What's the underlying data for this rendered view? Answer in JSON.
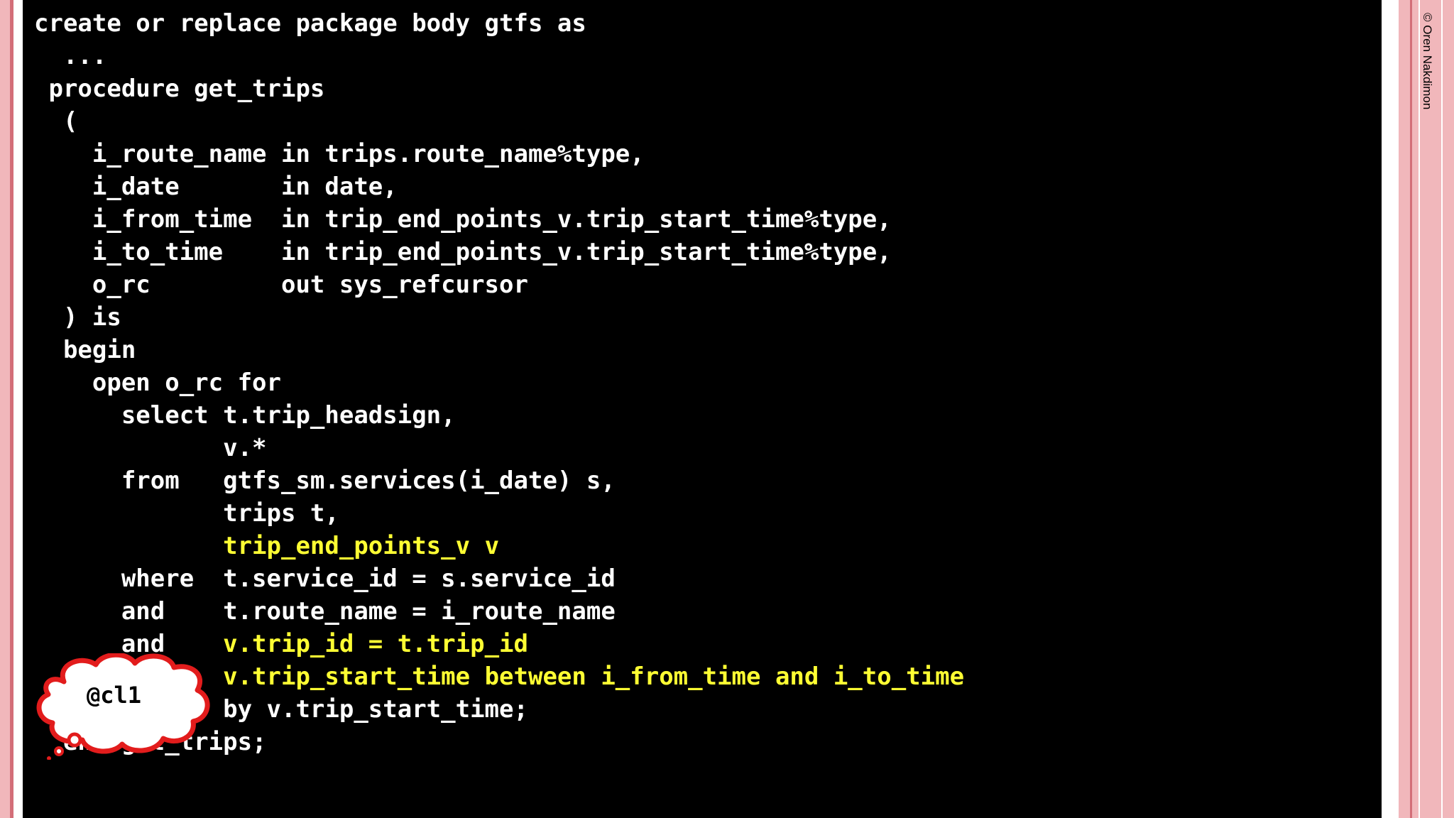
{
  "slide": {
    "copyright": "© Oren Nakdimon",
    "annotation": "@cl1"
  },
  "code": {
    "lines": [
      {
        "segments": [
          {
            "text": "create or replace package body gtfs as",
            "hl": false
          }
        ]
      },
      {
        "segments": [
          {
            "text": "  ...",
            "hl": false
          }
        ]
      },
      {
        "segments": [
          {
            "text": " procedure get_trips",
            "hl": false
          }
        ]
      },
      {
        "segments": [
          {
            "text": "  (",
            "hl": false
          }
        ]
      },
      {
        "segments": [
          {
            "text": "    i_route_name in trips.route_name%type,",
            "hl": false
          }
        ]
      },
      {
        "segments": [
          {
            "text": "    i_date       in date,",
            "hl": false
          }
        ]
      },
      {
        "segments": [
          {
            "text": "    i_from_time  in trip_end_points_v.trip_start_time%type,",
            "hl": false
          }
        ]
      },
      {
        "segments": [
          {
            "text": "    i_to_time    in trip_end_points_v.trip_start_time%type,",
            "hl": false
          }
        ]
      },
      {
        "segments": [
          {
            "text": "    o_rc         out sys_refcursor",
            "hl": false
          }
        ]
      },
      {
        "segments": [
          {
            "text": "  ) is",
            "hl": false
          }
        ]
      },
      {
        "segments": [
          {
            "text": "  begin",
            "hl": false
          }
        ]
      },
      {
        "segments": [
          {
            "text": "    open o_rc for",
            "hl": false
          }
        ]
      },
      {
        "segments": [
          {
            "text": "      select t.trip_headsign,",
            "hl": false
          }
        ]
      },
      {
        "segments": [
          {
            "text": "             v.*",
            "hl": false
          }
        ]
      },
      {
        "segments": [
          {
            "text": "      from   gtfs_sm.services(i_date) s,",
            "hl": false
          }
        ]
      },
      {
        "segments": [
          {
            "text": "             trips t,",
            "hl": false
          }
        ]
      },
      {
        "segments": [
          {
            "text": "             ",
            "hl": false
          },
          {
            "text": "trip_end_points_v v",
            "hl": true
          }
        ]
      },
      {
        "segments": [
          {
            "text": "      where  t.service_id = s.service_id",
            "hl": false
          }
        ]
      },
      {
        "segments": [
          {
            "text": "      and    t.route_name = i_route_name",
            "hl": false
          }
        ]
      },
      {
        "segments": [
          {
            "text": "      and    ",
            "hl": false
          },
          {
            "text": "v.trip_id = t.trip_id",
            "hl": true
          }
        ]
      },
      {
        "segments": [
          {
            "text": "             ",
            "hl": false
          },
          {
            "text": "v.trip_start_time between i_from_time and i_to_time",
            "hl": true
          }
        ]
      },
      {
        "segments": [
          {
            "text": "             by v.trip_start_time;",
            "hl": false
          }
        ]
      },
      {
        "segments": [
          {
            "text": "  end get_trips;",
            "hl": false
          }
        ]
      }
    ]
  },
  "colors": {
    "background": "#000000",
    "code_text": "#ffffff",
    "highlight": "#ffff33",
    "border_pink": "#f1b7bb",
    "border_dark": "#d36e78",
    "bubble_outline": "#e21c1c"
  }
}
